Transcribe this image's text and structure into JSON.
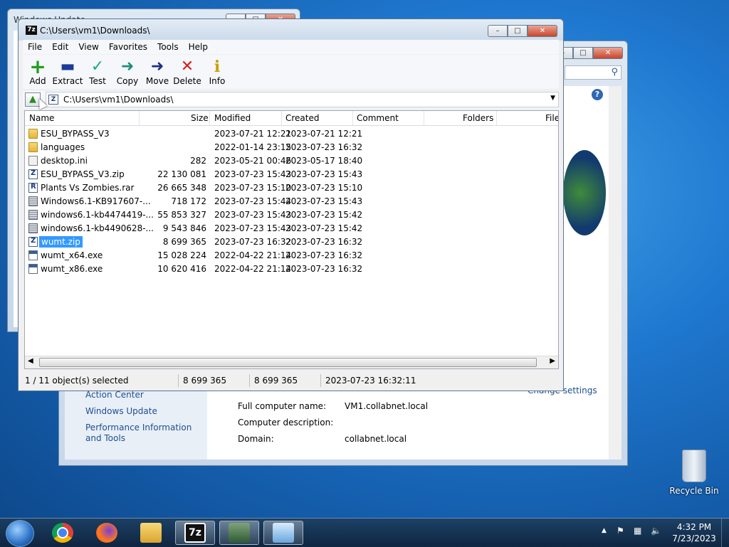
{
  "back_window_1": {
    "title": "Windows Update"
  },
  "system_window": {
    "left_links": [
      "Action Center",
      "Windows Update",
      "Performance Information and Tools"
    ],
    "rows": [
      {
        "label": "Full computer name:",
        "value": "VM1.collabnet.local"
      },
      {
        "label": "Computer description:",
        "value": ""
      },
      {
        "label": "Domain:",
        "value": "collabnet.local"
      }
    ],
    "change_settings": "Change settings"
  },
  "sevenzip": {
    "title": "C:\\Users\\vm1\\Downloads\\",
    "menu": [
      "File",
      "Edit",
      "View",
      "Favorites",
      "Tools",
      "Help"
    ],
    "toolbar": [
      {
        "label": "Add",
        "icon": "add-icon",
        "glyph": "+",
        "color": "#1f9e1f"
      },
      {
        "label": "Extract",
        "icon": "extract-icon",
        "glyph": "—",
        "color": "#1c3a9a"
      },
      {
        "label": "Test",
        "icon": "test-icon",
        "glyph": "✓",
        "color": "#1aa68e"
      },
      {
        "label": "Copy",
        "icon": "copy-icon",
        "glyph": "➜",
        "color": "#1c8f7a"
      },
      {
        "label": "Move",
        "icon": "move-icon",
        "glyph": "➜",
        "color": "#1c2f8a"
      },
      {
        "label": "Delete",
        "icon": "delete-icon",
        "glyph": "✕",
        "color": "#d62020"
      },
      {
        "label": "Info",
        "icon": "info-icon",
        "glyph": "i",
        "color": "#c9a000"
      }
    ],
    "address": "C:\\Users\\vm1\\Downloads\\",
    "columns": [
      "Name",
      "Size",
      "Modified",
      "Created",
      "Comment",
      "Folders",
      "File"
    ],
    "files": [
      {
        "name": "ESU_BYPASS_V3",
        "size": "",
        "modified": "2023-07-21 12:21",
        "created": "2023-07-21 12:21",
        "type": "folder"
      },
      {
        "name": "languages",
        "size": "",
        "modified": "2022-01-14 23:15",
        "created": "2023-07-23 16:32",
        "type": "folder"
      },
      {
        "name": "desktop.ini",
        "size": "282",
        "modified": "2023-05-21 00:46",
        "created": "2023-05-17 18:40",
        "type": "ini"
      },
      {
        "name": "ESU_BYPASS_V3.zip",
        "size": "22 130 081",
        "modified": "2023-07-23 15:43",
        "created": "2023-07-23 15:43",
        "type": "zip"
      },
      {
        "name": "Plants Vs Zombies.rar",
        "size": "26 665 348",
        "modified": "2023-07-23 15:10",
        "created": "2023-07-23 15:10",
        "type": "rar"
      },
      {
        "name": "Windows6.1-KB917607-...",
        "size": "718 172",
        "modified": "2023-07-23 15:44",
        "created": "2023-07-23 15:43",
        "type": "cab"
      },
      {
        "name": "windows6.1-kb4474419-...",
        "size": "55 853 327",
        "modified": "2023-07-23 15:43",
        "created": "2023-07-23 15:42",
        "type": "cab"
      },
      {
        "name": "windows6.1-kb4490628-...",
        "size": "9 543 846",
        "modified": "2023-07-23 15:43",
        "created": "2023-07-23 15:42",
        "type": "cab"
      },
      {
        "name": "wumt.zip",
        "size": "8 699 365",
        "modified": "2023-07-23 16:32",
        "created": "2023-07-23 16:32",
        "type": "zip",
        "selected": true
      },
      {
        "name": "wumt_x64.exe",
        "size": "15 028 224",
        "modified": "2022-04-22 21:14",
        "created": "2023-07-23 16:32",
        "type": "exe"
      },
      {
        "name": "wumt_x86.exe",
        "size": "10 620 416",
        "modified": "2022-04-22 21:14",
        "created": "2023-07-23 16:32",
        "type": "exe"
      }
    ],
    "status": {
      "selected": "1 / 11 object(s) selected",
      "size": "8 699 365",
      "packed": "8 699 365",
      "modified": "2023-07-23 16:32:11"
    }
  },
  "desktop": {
    "recycle_bin": "Recycle Bin"
  },
  "taskbar": {
    "time": "4:32 PM",
    "date": "7/23/2023",
    "icons": [
      "start-orb-icon",
      "chrome-icon",
      "firefox-icon",
      "file-explorer-icon",
      "7zip-icon",
      "network-app-icon",
      "control-panel-icon"
    ]
  },
  "colors": {
    "selection": "#3399ff",
    "link": "#1d4e91"
  }
}
